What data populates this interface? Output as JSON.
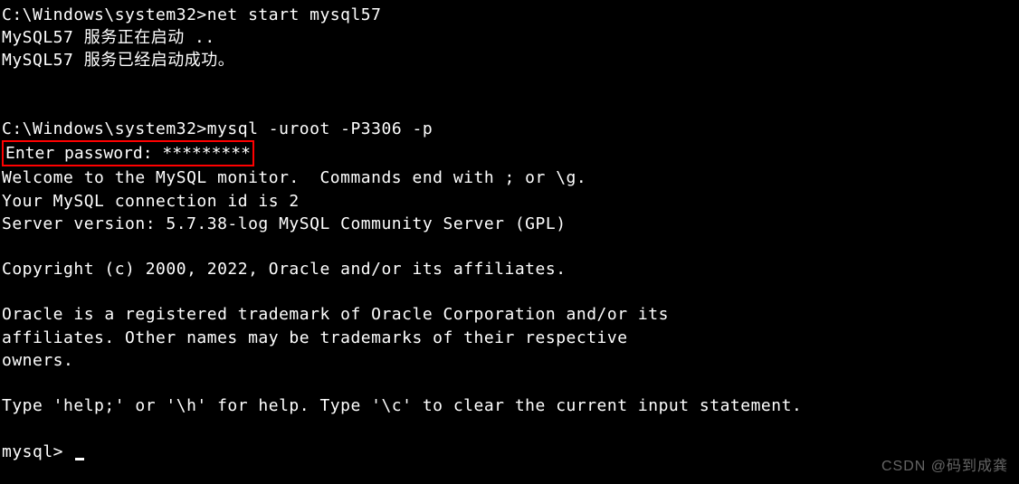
{
  "terminal": {
    "line1_prompt": "C:\\Windows\\system32>",
    "line1_cmd": "net start mysql57",
    "line2": "MySQL57 服务正在启动 ..",
    "line3": "MySQL57 服务已经启动成功。",
    "line4_prompt": "C:\\Windows\\system32>",
    "line4_cmd": "mysql -uroot -P3306 -p",
    "password_line": "Enter password: *********",
    "line6": "Welcome to the MySQL monitor.  Commands end with ; or \\g.",
    "line7": "Your MySQL connection id is 2",
    "line8": "Server version: 5.7.38-log MySQL Community Server (GPL)",
    "line9": "Copyright (c) 2000, 2022, Oracle and/or its affiliates.",
    "line10": "Oracle is a registered trademark of Oracle Corporation and/or its",
    "line11": "affiliates. Other names may be trademarks of their respective",
    "line12": "owners.",
    "line13": "Type 'help;' or '\\h' for help. Type '\\c' to clear the current input statement.",
    "prompt": "mysql> "
  },
  "watermark": "CSDN @码到成龚"
}
